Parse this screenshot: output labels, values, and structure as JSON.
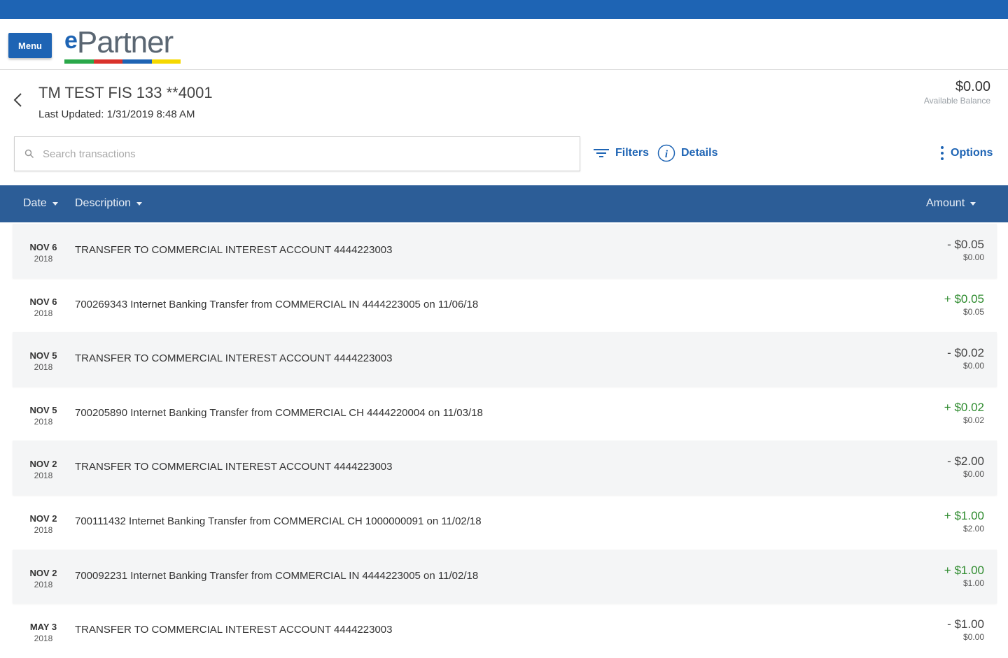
{
  "header": {
    "menu_label": "Menu",
    "logo_letter": "e",
    "logo_text": "Partner",
    "logo_colors": [
      "#2aa84a",
      "#d9322b",
      "#1e64b4",
      "#f5d800"
    ]
  },
  "account": {
    "title": "TM TEST FIS 133 **4001",
    "last_updated": "Last Updated: 1/31/2019 8:48 AM",
    "balance": "$0.00",
    "balance_label": "Available Balance"
  },
  "toolbar": {
    "search_placeholder": "Search transactions",
    "filters_label": "Filters",
    "details_label": "Details",
    "options_label": "Options"
  },
  "table": {
    "col_date": "Date",
    "col_description": "Description",
    "col_amount": "Amount",
    "rows": [
      {
        "md": "NOV 6",
        "yr": "2018",
        "desc": "TRANSFER TO COMMERCIAL INTEREST ACCOUNT 4444223003",
        "amount": "- $0.05",
        "balance": "$0.00",
        "type": "neg"
      },
      {
        "md": "NOV 6",
        "yr": "2018",
        "desc": "700269343 Internet Banking Transfer from COMMERCIAL IN 4444223005 on 11/06/18",
        "amount": "+ $0.05",
        "balance": "$0.05",
        "type": "pos"
      },
      {
        "md": "NOV 5",
        "yr": "2018",
        "desc": "TRANSFER TO COMMERCIAL INTEREST ACCOUNT 4444223003",
        "amount": "- $0.02",
        "balance": "$0.00",
        "type": "neg"
      },
      {
        "md": "NOV 5",
        "yr": "2018",
        "desc": "700205890 Internet Banking Transfer from COMMERCIAL CH 4444220004 on 11/03/18",
        "amount": "+ $0.02",
        "balance": "$0.02",
        "type": "pos"
      },
      {
        "md": "NOV 2",
        "yr": "2018",
        "desc": "TRANSFER TO COMMERCIAL INTEREST ACCOUNT 4444223003",
        "amount": "- $2.00",
        "balance": "$0.00",
        "type": "neg"
      },
      {
        "md": "NOV 2",
        "yr": "2018",
        "desc": "700111432 Internet Banking Transfer from COMMERCIAL CH 1000000091 on 11/02/18",
        "amount": "+ $1.00",
        "balance": "$2.00",
        "type": "pos"
      },
      {
        "md": "NOV 2",
        "yr": "2018",
        "desc": "700092231 Internet Banking Transfer from COMMERCIAL IN 4444223005 on 11/02/18",
        "amount": "+ $1.00",
        "balance": "$1.00",
        "type": "pos"
      },
      {
        "md": "MAY 3",
        "yr": "2018",
        "desc": "TRANSFER TO COMMERCIAL INTEREST ACCOUNT 4444223003",
        "amount": "- $1.00",
        "balance": "$0.00",
        "type": "neg"
      }
    ]
  }
}
